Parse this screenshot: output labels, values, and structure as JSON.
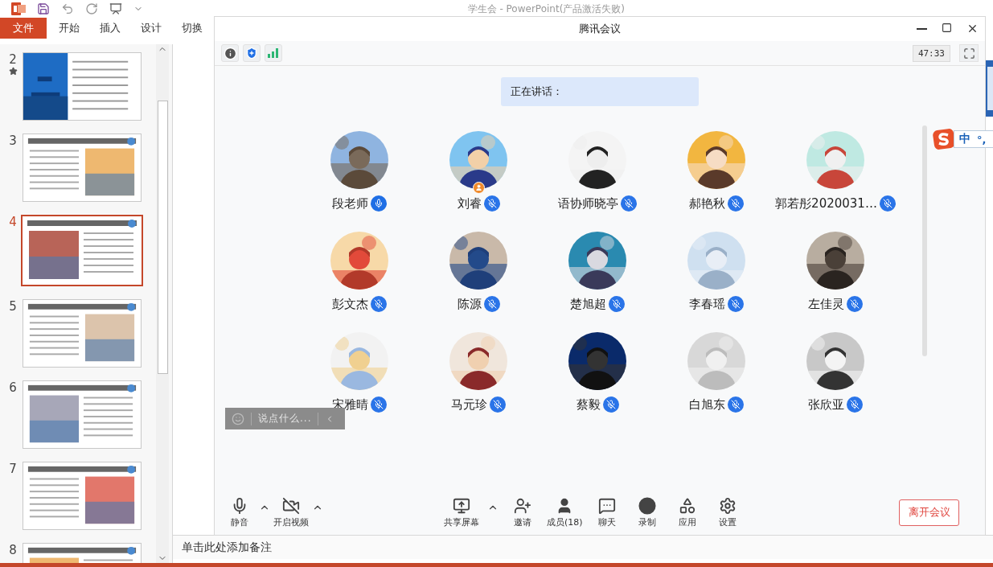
{
  "ppt": {
    "title": "学生会 - PowerPoint(产品激活失败)",
    "ribbon_tabs": [
      {
        "label": "文件",
        "kind": "file"
      },
      {
        "label": "开始",
        "kind": "tab"
      },
      {
        "label": "插入",
        "kind": "tab"
      },
      {
        "label": "设计",
        "kind": "tab"
      },
      {
        "label": "切换",
        "kind": "tab"
      }
    ],
    "slides": [
      {
        "number": "2",
        "starred": true,
        "selected": false
      },
      {
        "number": "3",
        "starred": false,
        "selected": false
      },
      {
        "number": "4",
        "starred": false,
        "selected": true
      },
      {
        "number": "5",
        "starred": false,
        "selected": false
      },
      {
        "number": "6",
        "starred": false,
        "selected": false
      },
      {
        "number": "7",
        "starred": false,
        "selected": false
      },
      {
        "number": "8",
        "starred": false,
        "selected": false
      }
    ],
    "notes_placeholder": "单击此处添加备注"
  },
  "meeting": {
    "title": "腾讯会议",
    "timer": "47:33",
    "speaking_label": "正在讲话：",
    "participants": [
      {
        "name": "段老师",
        "muted": false,
        "host": false
      },
      {
        "name": "刘睿",
        "muted": true,
        "host": true
      },
      {
        "name": "语协师晓亭",
        "muted": true,
        "host": false
      },
      {
        "name": "郝艳秋",
        "muted": true,
        "host": false
      },
      {
        "name": "郭若彤2020031…",
        "muted": true,
        "host": false
      },
      {
        "name": "彭文杰",
        "muted": true,
        "host": false
      },
      {
        "name": "陈源",
        "muted": true,
        "host": false
      },
      {
        "name": "楚旭超",
        "muted": true,
        "host": false
      },
      {
        "name": "李春瑶",
        "muted": true,
        "host": false
      },
      {
        "name": "左佳灵",
        "muted": true,
        "host": false
      },
      {
        "name": "宋雅晴",
        "muted": true,
        "host": false
      },
      {
        "name": "马元珍",
        "muted": true,
        "host": false
      },
      {
        "name": "蔡毅",
        "muted": true,
        "host": false
      },
      {
        "name": "白旭东",
        "muted": true,
        "host": false
      },
      {
        "name": "张欣亚",
        "muted": true,
        "host": false
      }
    ],
    "chat_placeholder": "说点什么...",
    "toolbar": [
      {
        "kind": "mic",
        "label": "静音",
        "menu": true
      },
      {
        "kind": "camera-off",
        "label": "开启视频",
        "menu": true
      },
      {
        "kind": "share",
        "label": "共享屏幕",
        "menu": true
      },
      {
        "kind": "invite",
        "label": "邀请",
        "menu": false
      },
      {
        "kind": "members",
        "label": "成员(18)",
        "menu": false
      },
      {
        "kind": "chat",
        "label": "聊天",
        "menu": false
      },
      {
        "kind": "record",
        "label": "录制",
        "menu": false
      },
      {
        "kind": "apps",
        "label": "应用",
        "menu": false
      },
      {
        "kind": "settings",
        "label": "设置",
        "menu": false
      }
    ],
    "leave_button": "离开会议"
  },
  "ime": {
    "mode": "中",
    "punctuation": "°,"
  }
}
